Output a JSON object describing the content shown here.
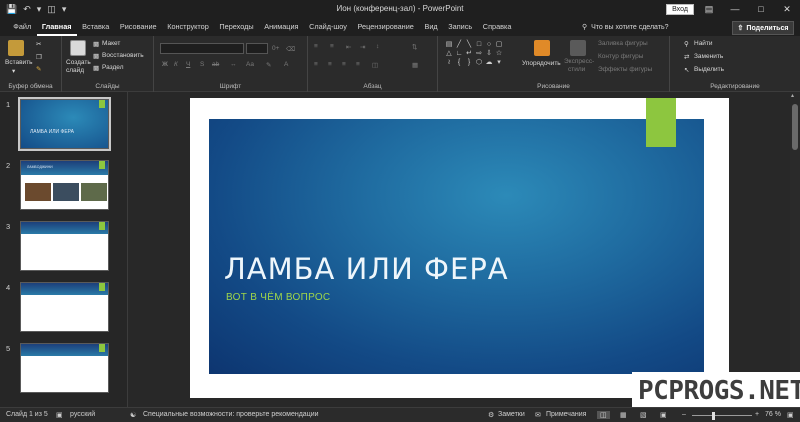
{
  "titlebar": {
    "title": "Ион (конференц-зал)  -  PowerPoint",
    "login_label": "Вход",
    "qat_icons": [
      "save-icon",
      "undo-icon",
      "start-from-beginning-icon",
      "customize-qat-icon"
    ],
    "window_controls": [
      "minimize-icon",
      "restore-icon",
      "close-icon",
      "ribbon-display-icon"
    ]
  },
  "tabs": [
    "Файл",
    "Главная",
    "Вставка",
    "Рисование",
    "Конструктор",
    "Переходы",
    "Анимация",
    "Слайд-шоу",
    "Рецензирование",
    "Вид",
    "Запись",
    "Справка"
  ],
  "active_tab": "Главная",
  "tell_me": "Что вы хотите сделать?",
  "share_label": "Поделиться",
  "ribbon": {
    "clipboard": {
      "paste": "Вставить",
      "label": "Буфер обмена"
    },
    "slides": {
      "new_slide_1": "Создать",
      "new_slide_2": "слайд",
      "layout": "Макет",
      "reset": "Восстановить",
      "section": "Раздел",
      "label": "Слайды"
    },
    "font": {
      "font_size": "0+",
      "formatting": [
        "Ж",
        "К",
        "Ч",
        "S",
        "ab"
      ],
      "label": "Шрифт"
    },
    "paragraph": {
      "label": "Абзац"
    },
    "drawing": {
      "arrange": "Упорядочить",
      "quick_styles_1": "Экспресс-",
      "quick_styles_2": "стили",
      "fill": "Заливка фигуры",
      "outline": "Контур фигуры",
      "effects": "Эффекты фигуры",
      "label": "Рисование"
    },
    "editing": {
      "find": "Найти",
      "replace": "Заменить",
      "select": "Выделить",
      "label": "Редактирование"
    }
  },
  "thumbnails": [
    {
      "number": "1",
      "title": "ЛАМБА ИЛИ ФЕРА"
    },
    {
      "number": "2",
      "title": "ЛАМБОДЖИНИ"
    },
    {
      "number": "3"
    },
    {
      "number": "4"
    },
    {
      "number": "5"
    }
  ],
  "slide": {
    "title": "ЛАМБА ИЛИ ФЕРА",
    "subtitle": "ВОТ В ЧЁМ ВОПРОС"
  },
  "watermark": "PCPROGS.NET",
  "statusbar": {
    "slide_info": "Слайд 1 из 5",
    "language": "русский",
    "accessibility": "Специальные возможности: проверьте рекомендации",
    "notes": "Заметки",
    "comments": "Примечания",
    "zoom": "76 %"
  },
  "colors": {
    "accent_green": "#8dc63f",
    "slide_blue": "#1f6ba0"
  }
}
